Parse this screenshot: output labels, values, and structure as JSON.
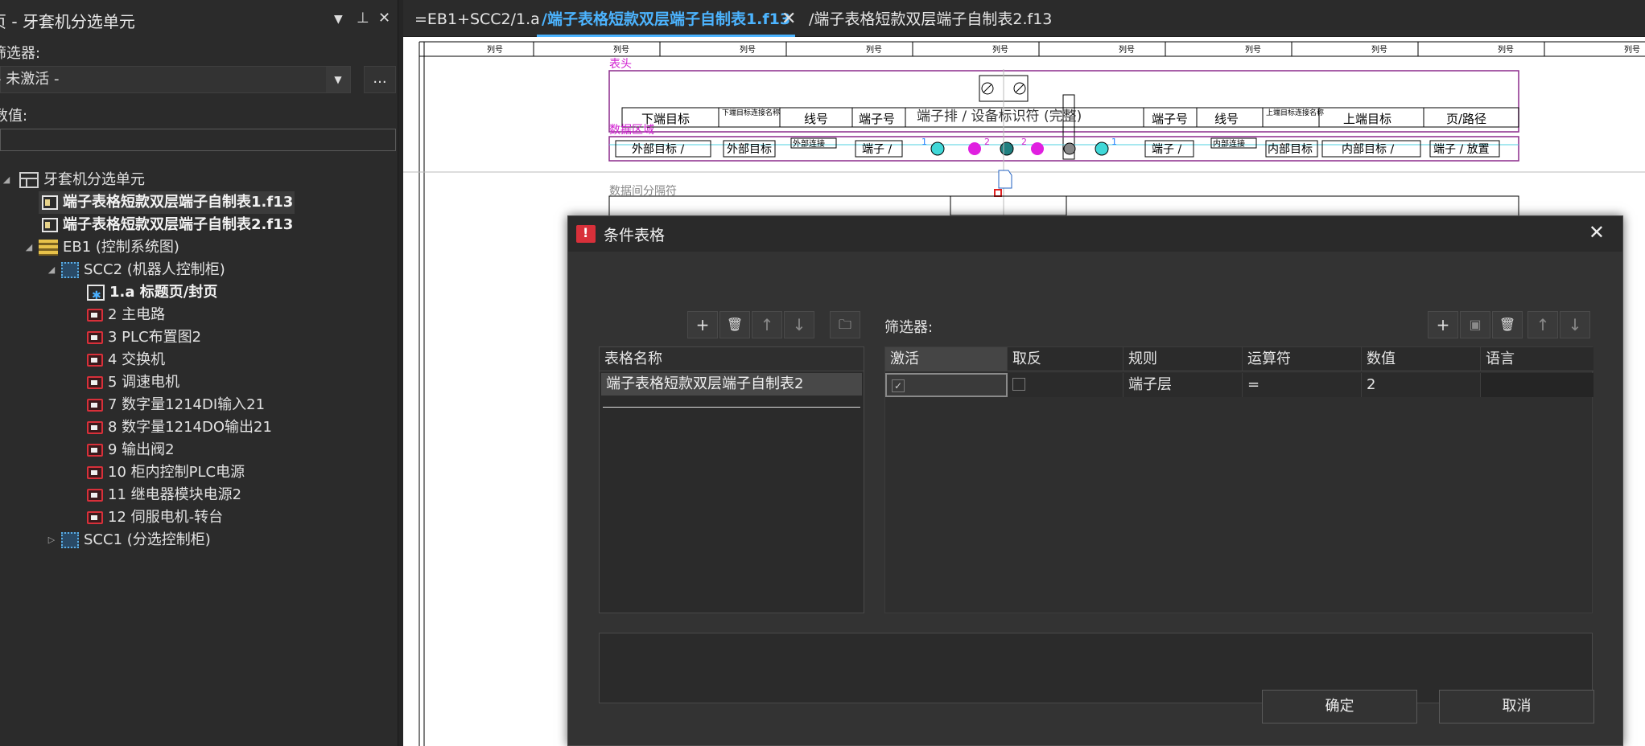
{
  "left_panel": {
    "title": "页 - 牙套机分选单元",
    "filter_label": "筛选器:",
    "filter_value": "- 未激活 -",
    "more_button": "...",
    "value_label": "数值:",
    "tree": [
      {
        "label": "牙套机分选单元",
        "icon": "project-icon"
      },
      {
        "label": "端子表格短款双层端子自制表1.f13",
        "icon": "form-icon"
      },
      {
        "label": "端子表格短款双层端子自制表2.f13",
        "icon": "form-icon"
      },
      {
        "label": "EB1 (控制系统图)",
        "icon": "plant-icon"
      },
      {
        "label": "SCC2 (机器人控制柜)",
        "icon": "location-icon"
      },
      {
        "label": "1.a 标题页/封页",
        "icon": "cover-page-icon"
      },
      {
        "label": "2 主电路",
        "icon": "page-icon"
      },
      {
        "label": "3 PLC布置图2",
        "icon": "page-icon"
      },
      {
        "label": "4 交换机",
        "icon": "page-icon"
      },
      {
        "label": "5 调速电机",
        "icon": "page-icon"
      },
      {
        "label": "7 数字量1214DI输入21",
        "icon": "page-icon"
      },
      {
        "label": "8 数字量1214DO输出21",
        "icon": "page-icon"
      },
      {
        "label": "9 输出阀2",
        "icon": "page-icon"
      },
      {
        "label": "10 柜内控制PLC电源",
        "icon": "page-icon"
      },
      {
        "label": "11 继电器模块电源2",
        "icon": "page-icon"
      },
      {
        "label": "12 伺服电机-转台",
        "icon": "page-icon"
      },
      {
        "label": "SCC1 (分选控制柜)",
        "icon": "location-icon"
      }
    ]
  },
  "tabs": [
    {
      "label": "=EB1+SCC2/1.a"
    },
    {
      "label": "/端子表格短款双层端子自制表1.f13"
    },
    {
      "label": "/端子表格短款双层端子自制表2.f13"
    }
  ],
  "canvas": {
    "column_label": "列号",
    "header_label": "表头",
    "data_area_label": "数据区域",
    "separator_label": "数据间分隔符",
    "title_text": "端子排 / 设备标识符 (完整)",
    "cols_left": [
      "下端目标",
      "下端目标连接名称",
      "线号",
      "端子号"
    ],
    "cols_right": [
      "端子号",
      "线号",
      "上端目标连接名称",
      "上端目标",
      "页/路径"
    ],
    "cells_left": [
      "外部目标 /",
      "外部目标",
      "外部连接",
      "端子 /"
    ],
    "cells_right": [
      "端子 /",
      "内部连接",
      "内部目标",
      "内部目标 /",
      "端子 / 放置"
    ],
    "terminal_numbers": [
      "1",
      "2",
      "2",
      "1"
    ]
  },
  "dialog": {
    "title": "条件表格",
    "list_header": "表格名称",
    "list_items": [
      "端子表格短款双层端子自制表2"
    ],
    "filter_label": "筛选器:",
    "columns": [
      "激活",
      "取反",
      "规则",
      "运算符",
      "数值",
      "语言"
    ],
    "rows": [
      {
        "active": "✓",
        "negate": "",
        "rule": "端子层",
        "operator": "=",
        "value": "2",
        "language": ""
      }
    ],
    "ok_button": "确定",
    "cancel_button": "取消"
  }
}
